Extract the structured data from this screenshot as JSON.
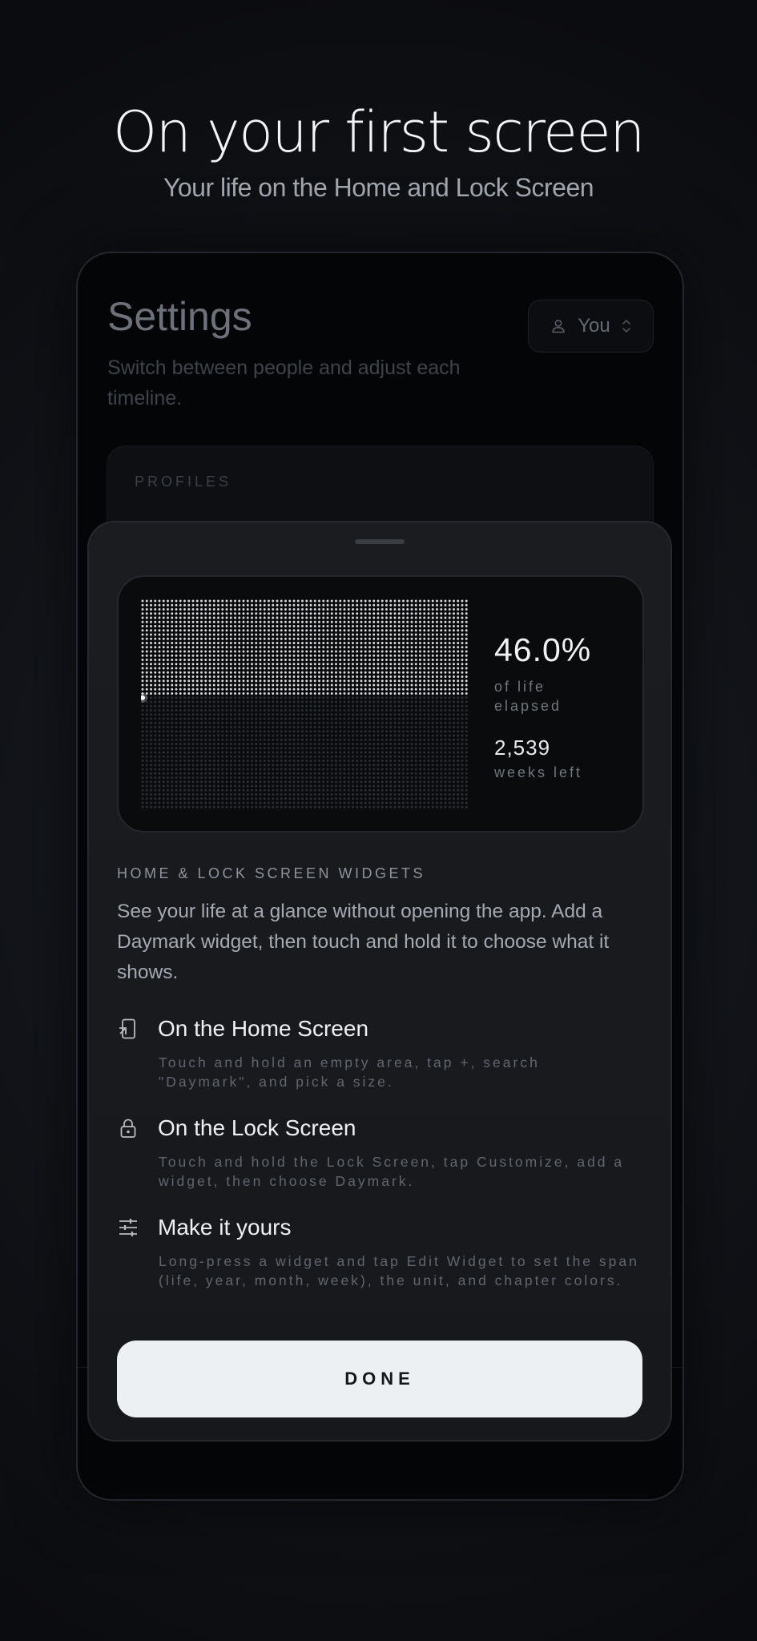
{
  "hero": {
    "title": "On your first screen",
    "subtitle": "Your life on the Home and Lock Screen"
  },
  "settings": {
    "title": "Settings",
    "description": "Switch between people and adjust each timeline.",
    "profile_selector": {
      "label": "You",
      "icon": "person-icon",
      "chevron": "chevron-up-down-icon"
    },
    "profiles_label": "PROFILES"
  },
  "widget": {
    "percent": "46.0%",
    "percent_label": "of life elapsed",
    "weeks": "2,539",
    "weeks_label": "weeks left",
    "elapsed_fraction": 0.46
  },
  "sheet": {
    "section_label": "HOME & LOCK SCREEN WIDGETS",
    "intro": "See your life at a glance without opening the app. Add a Daymark widget, then touch and hold it to choose what it shows.",
    "steps": [
      {
        "icon": "home-screen-add-icon",
        "title": "On the Home Screen",
        "description": "Touch and hold an empty area, tap +, search \"Daymark\", and pick a size."
      },
      {
        "icon": "lock-icon",
        "title": "On the Lock Screen",
        "description": "Touch and hold the Lock Screen, tap Customize, add a widget, then choose Daymark."
      },
      {
        "icon": "sliders-icon",
        "title": "Make it yours",
        "description": "Long-press a widget and tap Edit Widget to set the span (life, year, month, week), the unit, and chapter colors."
      }
    ],
    "done_label": "DONE"
  }
}
